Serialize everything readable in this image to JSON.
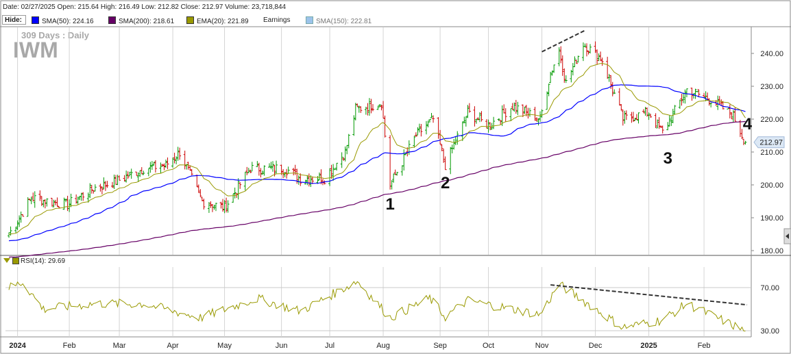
{
  "header": {
    "info_line": "Date: 02/27/2025   Open: 215.64   High: 216.49   Low: 212.82   Close: 212.97   Volume: 23,718,844"
  },
  "toolbar": {
    "hide_label": "Hide:",
    "legend": [
      {
        "label": "SMA(50): 224.16",
        "color": "#0000ff"
      },
      {
        "label": "SMA(200): 218.61",
        "color": "#660066"
      },
      {
        "label": "EMA(20): 221.89",
        "color": "#999900"
      },
      {
        "label": "Earnings",
        "color": ""
      },
      {
        "label": "SMA(150): 222.81",
        "color": "#9cc3ea"
      }
    ]
  },
  "overlay": {
    "period": "309  Days : Daily",
    "ticker": "IWM"
  },
  "rsi_panel": {
    "label": "RSI(14): 29.69"
  },
  "colors": {
    "up": "#009900",
    "down": "#cc0000",
    "sma50": "#0000ff",
    "sma200": "#660066",
    "ema20": "#999900",
    "rsi": "#999900",
    "last_price_bg": "#dce8f5"
  },
  "chart_data": {
    "type": "line",
    "price_axis": {
      "ticks": [
        "240.00",
        "230.00",
        "220.00",
        "210.00",
        "200.00",
        "190.00",
        "180.00"
      ],
      "range": [
        180,
        245
      ],
      "scale": "linear"
    },
    "rsi_axis": {
      "ticks": [
        "70.00",
        "30.00"
      ],
      "range": [
        27,
        82
      ]
    },
    "x_labels": [
      "2024",
      "Feb",
      "Mar",
      "Apr",
      "May",
      "Jun",
      "Jul",
      "Aug",
      "Sep",
      "Oct",
      "Nov",
      "Dec",
      "2025",
      "Feb"
    ],
    "last_price": "212.97",
    "annotations": [
      "1",
      "2",
      "3",
      "4"
    ],
    "approx_close": [
      {
        "date": "2023-12-28",
        "close": 185
      },
      {
        "date": "2024-01-10",
        "close": 196
      },
      {
        "date": "2024-01-31",
        "close": 194
      },
      {
        "date": "2024-02-15",
        "close": 199
      },
      {
        "date": "2024-02-28",
        "close": 201
      },
      {
        "date": "2024-03-15",
        "close": 205
      },
      {
        "date": "2024-03-28",
        "close": 206
      },
      {
        "date": "2024-04-05",
        "close": 210
      },
      {
        "date": "2024-04-18",
        "close": 195
      },
      {
        "date": "2024-05-01",
        "close": 193
      },
      {
        "date": "2024-05-16",
        "close": 205
      },
      {
        "date": "2024-06-05",
        "close": 205
      },
      {
        "date": "2024-06-14",
        "close": 202
      },
      {
        "date": "2024-06-28",
        "close": 202
      },
      {
        "date": "2024-07-10",
        "close": 210
      },
      {
        "date": "2024-07-16",
        "close": 223
      },
      {
        "date": "2024-07-31",
        "close": 225
      },
      {
        "date": "2024-08-05",
        "close": 200
      },
      {
        "date": "2024-08-20",
        "close": 215
      },
      {
        "date": "2024-08-30",
        "close": 220
      },
      {
        "date": "2024-09-06",
        "close": 206
      },
      {
        "date": "2024-09-19",
        "close": 222
      },
      {
        "date": "2024-10-01",
        "close": 218
      },
      {
        "date": "2024-10-15",
        "close": 224
      },
      {
        "date": "2024-10-31",
        "close": 220
      },
      {
        "date": "2024-11-06",
        "close": 234
      },
      {
        "date": "2024-11-11",
        "close": 241
      },
      {
        "date": "2024-11-15",
        "close": 231
      },
      {
        "date": "2024-11-25",
        "close": 243
      },
      {
        "date": "2024-12-06",
        "close": 238
      },
      {
        "date": "2024-12-18",
        "close": 220
      },
      {
        "date": "2025-01-02",
        "close": 222
      },
      {
        "date": "2025-01-10",
        "close": 216
      },
      {
        "date": "2025-01-24",
        "close": 229
      },
      {
        "date": "2025-02-07",
        "close": 226
      },
      {
        "date": "2025-02-20",
        "close": 221
      },
      {
        "date": "2025-02-27",
        "close": 212.97
      }
    ],
    "approx_rsi": [
      {
        "date": "2023-12-28",
        "rsi": 70
      },
      {
        "date": "2024-01-05",
        "rsi": 75
      },
      {
        "date": "2024-01-17",
        "rsi": 50
      },
      {
        "date": "2024-02-15",
        "rsi": 55
      },
      {
        "date": "2024-03-15",
        "rsi": 55
      },
      {
        "date": "2024-04-17",
        "rsi": 42
      },
      {
        "date": "2024-05-20",
        "rsi": 60
      },
      {
        "date": "2024-06-14",
        "rsi": 48
      },
      {
        "date": "2024-07-17",
        "rsi": 76
      },
      {
        "date": "2024-08-05",
        "rsi": 42
      },
      {
        "date": "2024-08-28",
        "rsi": 60
      },
      {
        "date": "2024-09-06",
        "rsi": 43
      },
      {
        "date": "2024-09-19",
        "rsi": 58
      },
      {
        "date": "2024-10-31",
        "rsi": 45
      },
      {
        "date": "2024-11-11",
        "rsi": 73
      },
      {
        "date": "2024-12-18",
        "rsi": 33
      },
      {
        "date": "2025-01-10",
        "rsi": 40
      },
      {
        "date": "2025-01-24",
        "rsi": 55
      },
      {
        "date": "2025-02-27",
        "rsi": 29.69
      }
    ]
  }
}
